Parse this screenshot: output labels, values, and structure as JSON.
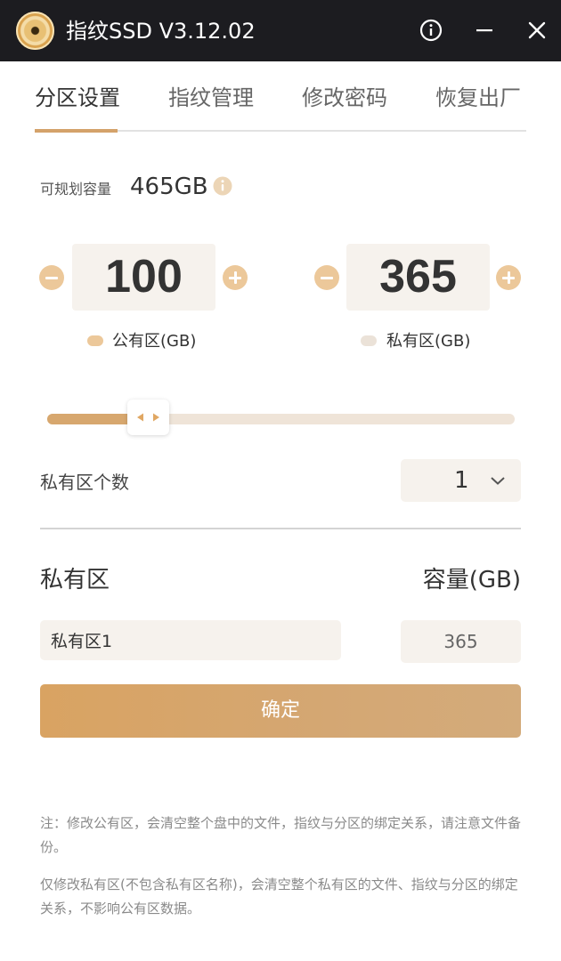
{
  "titlebar": {
    "title": "指纹SSD V3.12.02",
    "icons": [
      "disc-logo-icon",
      "info-icon",
      "minimize-icon",
      "close-icon"
    ]
  },
  "tabs": [
    {
      "label": "分区设置",
      "active": true
    },
    {
      "label": "指纹管理",
      "active": false
    },
    {
      "label": "修改密码",
      "active": false
    },
    {
      "label": "恢复出厂",
      "active": false
    }
  ],
  "capacity": {
    "label": "可规划容量",
    "value": "465GB"
  },
  "public": {
    "value": "100",
    "legend": "公有区(GB)"
  },
  "private": {
    "value": "365",
    "legend": "私有区(GB)"
  },
  "slider": {
    "public_fraction": 0.215
  },
  "private_count": {
    "label": "私有区个数",
    "value": "1"
  },
  "list": {
    "header_name": "私有区",
    "header_size": "容量(GB)",
    "rows": [
      {
        "name": "私有区1",
        "size": "365"
      }
    ]
  },
  "confirm_label": "确定",
  "notes": [
    "注：修改公有区，会清空整个盘中的文件，指纹与分区的绑定关系，请注意文件备份。",
    "仅修改私有区(不包含私有区名称)，会清空整个私有区的文件、指纹与分区的绑定关系，不影响公有区数据。"
  ],
  "colors": {
    "titlebar_bg": "#1c1c20",
    "accent": "#d4a26a",
    "public_legend": "#ecc89a",
    "private_legend": "#ebe2d8",
    "field_bg": "#f6f2ed"
  }
}
